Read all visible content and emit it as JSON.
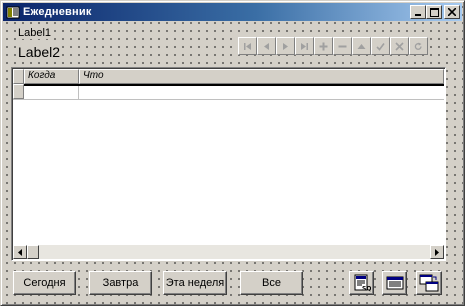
{
  "window": {
    "title": "Ежедневник"
  },
  "labels": {
    "label1": "Label1",
    "label2": "Label2"
  },
  "navigator": {
    "buttons": [
      {
        "name": "first",
        "icon": "first-icon"
      },
      {
        "name": "prior",
        "icon": "prior-icon"
      },
      {
        "name": "next",
        "icon": "next-icon"
      },
      {
        "name": "last",
        "icon": "last-icon"
      },
      {
        "name": "insert",
        "icon": "insert-icon"
      },
      {
        "name": "delete",
        "icon": "delete-icon"
      },
      {
        "name": "edit",
        "icon": "edit-icon"
      },
      {
        "name": "post",
        "icon": "post-icon"
      },
      {
        "name": "cancel",
        "icon": "cancel-icon"
      },
      {
        "name": "refresh",
        "icon": "refresh-icon"
      }
    ],
    "enabled": false
  },
  "grid": {
    "columns": [
      "Когда",
      "Что"
    ],
    "rows": [
      [
        "",
        ""
      ]
    ]
  },
  "buttons": {
    "today": "Сегодня",
    "tomorrow": "Завтра",
    "this_week": "Эта неделя",
    "all": "Все"
  },
  "icon_buttons": [
    "database-query-icon",
    "table-view-icon",
    "switch-view-icon"
  ],
  "colors": {
    "title_start": "#0a246a",
    "title_end": "#a6caf0",
    "face": "#d4d0c8",
    "disabled": "#a0a0a0"
  }
}
